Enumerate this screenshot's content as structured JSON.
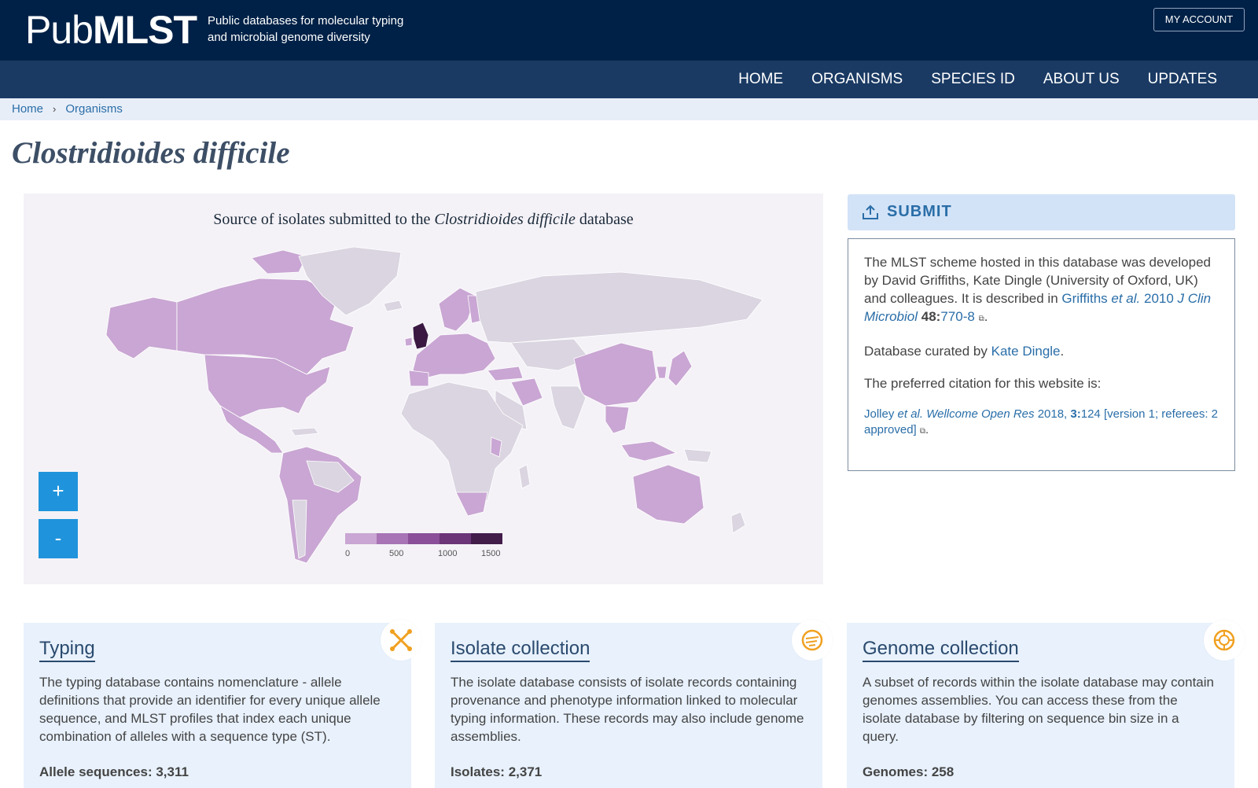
{
  "header": {
    "logo_part1": "Pub",
    "logo_part2": "MLST",
    "tagline_line1": "Public databases for molecular typing",
    "tagline_line2": "and microbial genome diversity",
    "account_button": "MY ACCOUNT"
  },
  "nav": [
    "HOME",
    "ORGANISMS",
    "SPECIES ID",
    "ABOUT US",
    "UPDATES"
  ],
  "breadcrumb": [
    "Home",
    "Organisms"
  ],
  "page_title": "Clostridioides difficile",
  "map": {
    "title_prefix": "Source of isolates submitted to the",
    "title_species": "Clostridioides difficile",
    "title_suffix": "database",
    "zoom_in": "+",
    "zoom_out": "-",
    "legend_labels": [
      "0",
      "500",
      "1000",
      "1500"
    ],
    "legend_colors": [
      "#c9a6d3",
      "#a874b5",
      "#8a4f98",
      "#6b3577",
      "#421d4a"
    ],
    "colors": {
      "none": "#dad5e0",
      "low": "#c9a6d3",
      "max": "#3a1842",
      "border": "#ffffff",
      "background": "#f4f2f7"
    }
  },
  "submit": {
    "label": "SUBMIT"
  },
  "info": {
    "scheme_text": "The MLST scheme hosted in this database was developed by David Griffiths, Kate Dingle (University of Oxford, UK) and colleagues. It is described in",
    "ref_author": "Griffiths",
    "ref_etal": "et al.",
    "ref_year": "2010",
    "ref_journal": "J Clin Microbiol",
    "ref_volume": "48:",
    "ref_pages": "770-8",
    "curated_by": "Database curated by",
    "curator": "Kate Dingle",
    "citation_intro": "The preferred citation for this website is:",
    "cite_author": "Jolley",
    "cite_etal": "et al.",
    "cite_journal": "Wellcome Open Res",
    "cite_year": "2018,",
    "cite_volume": "3:",
    "cite_rest": "124 [version 1; referees: 2 approved]"
  },
  "cards": [
    {
      "title": "Typing",
      "text": "The typing database contains nomenclature - allele definitions that provide an identifier for every unique allele sequence, and MLST profiles that index each unique combination of alleles with a sequence type (ST).",
      "stat": "Allele sequences: 3,311",
      "icon": "typing-icon"
    },
    {
      "title": "Isolate collection",
      "text": "The isolate database consists of isolate records containing provenance and phenotype information linked to molecular typing information. These records may also include genome assemblies.",
      "stat": "Isolates: 2,371",
      "icon": "isolate-icon"
    },
    {
      "title": "Genome collection",
      "text": "A subset of records within the isolate database may contain genomes assemblies. You can access these from the isolate database by filtering on sequence bin size in a query.",
      "stat": "Genomes: 258",
      "icon": "genome-icon"
    }
  ]
}
